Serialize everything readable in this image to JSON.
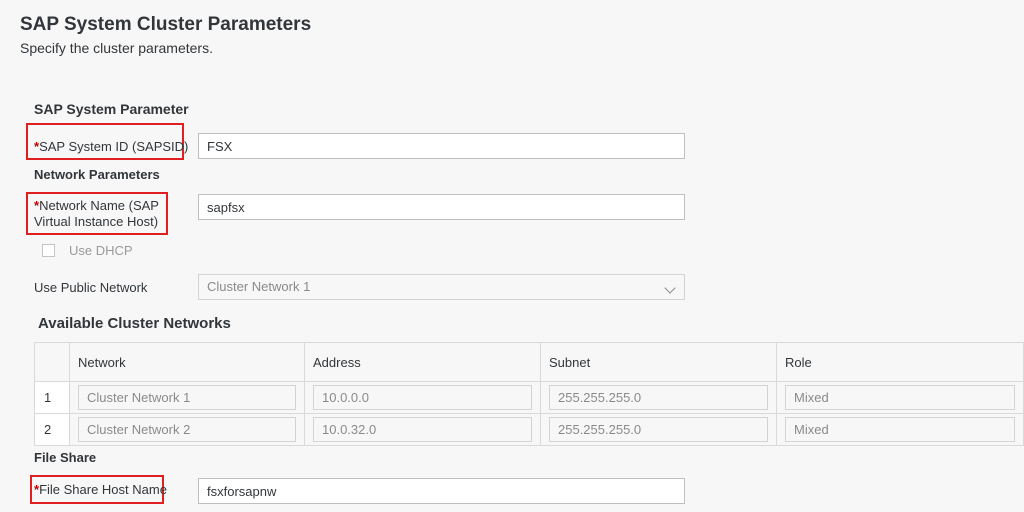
{
  "header": {
    "title": "SAP System Cluster Parameters",
    "subtitle": "Specify the cluster parameters."
  },
  "sap_system": {
    "section_title": "SAP System Parameter",
    "sapsid_label": "SAP System ID (SAPSID)",
    "sapsid_value": "FSX"
  },
  "network": {
    "section_title": "Network Parameters",
    "network_name_label_line1": "Network Name (SAP",
    "network_name_label_line2": "Virtual Instance Host)",
    "network_name_value": "sapfsx",
    "dhcp_label": "Use DHCP",
    "dhcp_checked": false,
    "public_network_label": "Use Public Network",
    "public_network_value": "Cluster Network 1"
  },
  "cluster_networks": {
    "section_title": "Available Cluster Networks",
    "columns": [
      "Network",
      "Address",
      "Subnet",
      "Role"
    ],
    "rows": [
      {
        "index": "1",
        "network": "Cluster Network 1",
        "address": "10.0.0.0",
        "subnet": "255.255.255.0",
        "role": "Mixed"
      },
      {
        "index": "2",
        "network": "Cluster Network 2",
        "address": "10.0.32.0",
        "subnet": "255.255.255.0",
        "role": "Mixed"
      }
    ]
  },
  "file_share": {
    "section_title": "File Share",
    "host_name_label": "File Share Host Name",
    "host_name_value": "fsxforsapnw"
  },
  "colors": {
    "required_marker": "#bb0000",
    "highlight_box": "#e02020",
    "background": "#f7f7f7"
  }
}
